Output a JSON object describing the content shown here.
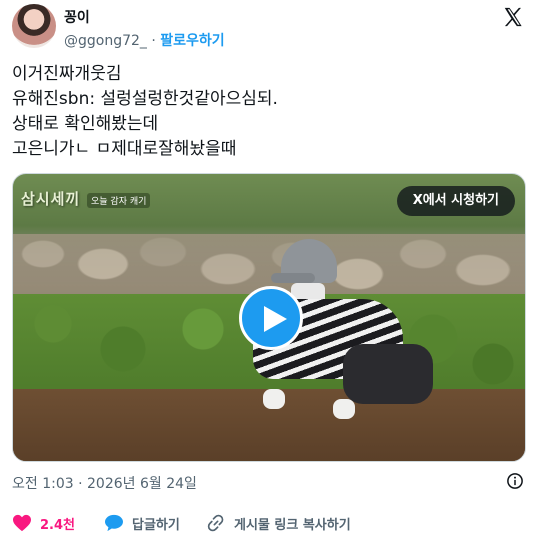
{
  "author": {
    "display_name": "꽁이",
    "handle": "@ggong72_",
    "separator": "·",
    "follow_label": "팔로우하기"
  },
  "tweet": {
    "lines": [
      "이거진짜개웃김",
      "유해진sbn: 설렁설렁한것같아으심되.",
      "상태로 확인해봤는데",
      "고은니가ㄴ ㅁ제대로잘해놨을때"
    ]
  },
  "media": {
    "watch_on_x_label": "X에서 시청하기",
    "show_logo": "삼시세끼",
    "show_caption": "오늘 감자 캐기",
    "accent": "#1d9bf0"
  },
  "meta": {
    "timestamp": "오전 1:03 · 2026년 6월 24일"
  },
  "actions": {
    "like_count": "2.4천",
    "reply_label": "답글하기",
    "copy_link_label": "게시물 링크 복사하기"
  },
  "colors": {
    "like": "#f91880",
    "reply": "#1d9bf0",
    "muted": "#536471",
    "text": "#0f1419"
  }
}
